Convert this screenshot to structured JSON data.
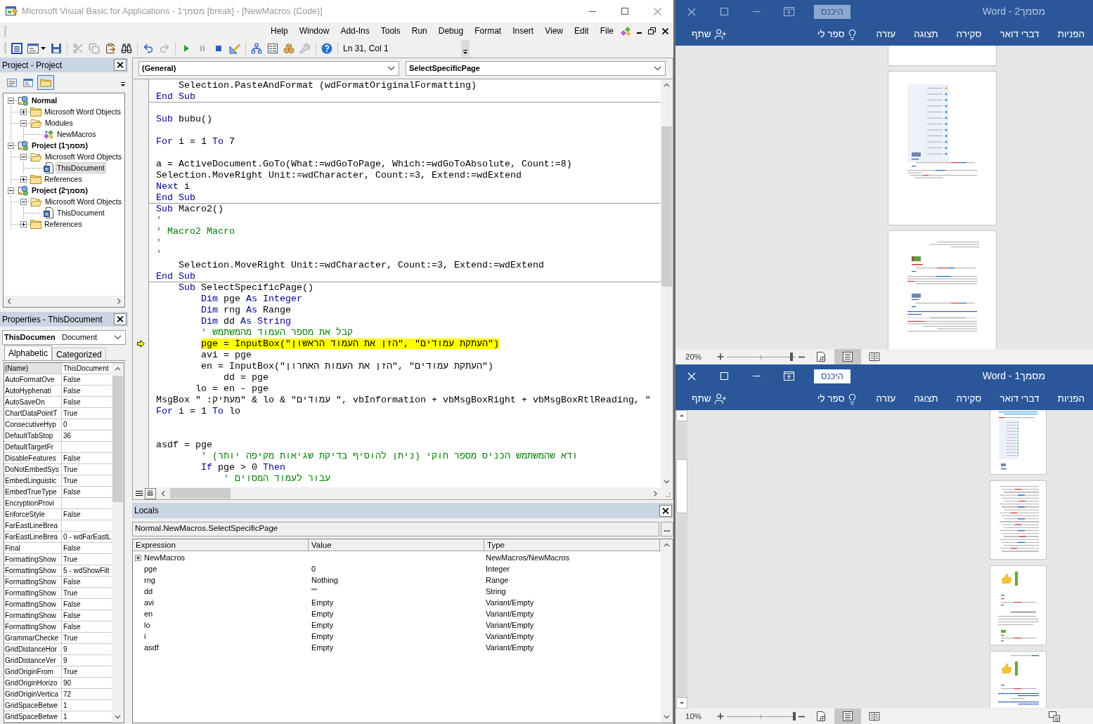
{
  "vba": {
    "title": "Microsoft Visual Basic for Applications - מסמך1 [break] - [NewMacros (Code)]",
    "menu": [
      "Help",
      "Window",
      "Add-Ins",
      "Tools",
      "Run",
      "Debug",
      "Format",
      "Insert",
      "View",
      "Edit",
      "File"
    ],
    "toolbar": {
      "position": "Ln 31, Col 1"
    },
    "project": {
      "title": "Project - Project",
      "view_buttons": [
        {
          "kind": "code",
          "selected": false
        },
        {
          "kind": "object",
          "selected": false
        },
        {
          "kind": "folders",
          "selected": true
        }
      ],
      "tree": [
        {
          "label": "Normal",
          "kind": "project",
          "expanded": true,
          "selected": false,
          "children": [
            {
              "label": "Microsoft Word Objects",
              "kind": "folder",
              "expanded": false,
              "selected": false
            },
            {
              "label": "Modules",
              "kind": "folder",
              "expanded": true,
              "selected": false,
              "children": [
                {
                  "label": "NewMacros",
                  "kind": "module",
                  "selected": false
                }
              ]
            }
          ]
        },
        {
          "label": "Project (מסמך1)",
          "kind": "project",
          "expanded": true,
          "selected": false,
          "children": [
            {
              "label": "Microsoft Word Objects",
              "kind": "folder",
              "expanded": true,
              "selected": false,
              "children": [
                {
                  "label": "ThisDocument",
                  "kind": "document",
                  "selected": true
                }
              ]
            },
            {
              "label": "References",
              "kind": "folder",
              "expanded": false,
              "selected": false
            }
          ]
        },
        {
          "label": "Project (מסמך2)",
          "kind": "project",
          "expanded": true,
          "selected": false,
          "children": [
            {
              "label": "Microsoft Word Objects",
              "kind": "folder",
              "expanded": true,
              "selected": false,
              "children": [
                {
                  "label": "ThisDocument",
                  "kind": "document",
                  "selected": false
                }
              ]
            },
            {
              "label": "References",
              "kind": "folder",
              "expanded": false,
              "selected": false
            }
          ]
        }
      ]
    },
    "properties": {
      "title": "Properties - ThisDocument",
      "object": "ThisDocumen",
      "object_type": "Document",
      "tabs": [
        {
          "label": "Alphabetic",
          "selected": true
        },
        {
          "label": "Categorized",
          "selected": false
        }
      ],
      "rows": [
        {
          "name": "(Name)",
          "value": "ThisDocument",
          "selected": true
        },
        {
          "name": "AutoFormatOve",
          "value": "False",
          "selected": false
        },
        {
          "name": "AutoHyphenati",
          "value": "False",
          "selected": false
        },
        {
          "name": "AutoSaveOn",
          "value": "False",
          "selected": false
        },
        {
          "name": "ChartDataPointT",
          "value": "True",
          "selected": false
        },
        {
          "name": "ConsecutiveHyp",
          "value": "0",
          "selected": false
        },
        {
          "name": "DefaultTabStop",
          "value": "36",
          "selected": false
        },
        {
          "name": "DefaultTargetFr",
          "selected": false
        },
        {
          "name": "DisableFeatures",
          "value": "False",
          "selected": false
        },
        {
          "name": "DoNotEmbedSys",
          "value": "True",
          "selected": false
        },
        {
          "name": "EmbedLinguistic",
          "value": "True",
          "selected": false
        },
        {
          "name": "EmbedTrueType",
          "value": "False",
          "selected": false
        },
        {
          "name": "EncryptionProvi",
          "selected": false
        },
        {
          "name": "EnforceStyle",
          "value": "False",
          "selected": false
        },
        {
          "name": "FarEastLineBrea",
          "selected": false
        },
        {
          "name": "FarEastLineBrea",
          "value": "0 - wdFarEastL",
          "selected": false
        },
        {
          "name": "Final",
          "value": "False",
          "selected": false
        },
        {
          "name": "FormattingShow",
          "value": "True",
          "selected": false
        },
        {
          "name": "FormattingShow",
          "value": "5 - wdShowFilt",
          "selected": false
        },
        {
          "name": "FormattingShow",
          "value": "False",
          "selected": false
        },
        {
          "name": "FormattingShow",
          "value": "True",
          "selected": false
        },
        {
          "name": "FormattingShow",
          "value": "False",
          "selected": false
        },
        {
          "name": "FormattingShow",
          "value": "False",
          "selected": false
        },
        {
          "name": "FormattingShow",
          "value": "False",
          "selected": false
        },
        {
          "name": "GrammarChecke",
          "value": "True",
          "selected": false
        },
        {
          "name": "GridDistanceHor",
          "value": "9",
          "selected": false
        },
        {
          "name": "GridDistanceVer",
          "value": "9",
          "selected": false
        },
        {
          "name": "GridOriginFrom",
          "value": "True",
          "selected": false
        },
        {
          "name": "GridOriginHorizo",
          "value": "90",
          "selected": false
        },
        {
          "name": "GridOriginVertica",
          "value": "72",
          "selected": false
        },
        {
          "name": "GridSpaceBetwe",
          "value": "1",
          "selected": false
        },
        {
          "name": "GridSpaceBetwe",
          "value": "1",
          "selected": false
        }
      ]
    },
    "code": {
      "object": "(General)",
      "procedure": "SelectSpecificPage",
      "procedures": [
        {
          "lines": [
            {
              "kind": "code",
              "current": false,
              "segments": [
                {
                  "kind": "plain",
                  "text": "    Selection.PasteAndFormat (wdFormatOriginalFormatting)"
                }
              ]
            },
            {
              "kind": "code",
              "current": false,
              "segments": [
                {
                  "kind": "keyword",
                  "text": "End Sub"
                }
              ]
            }
          ]
        },
        {
          "lines": [
            {
              "kind": "blank"
            },
            {
              "kind": "code",
              "current": false,
              "segments": [
                {
                  "kind": "keyword",
                  "text": "Sub"
                },
                {
                  "kind": "plain",
                  "text": " bubu()"
                }
              ]
            },
            {
              "kind": "blank"
            },
            {
              "kind": "code",
              "current": false,
              "segments": [
                {
                  "kind": "keyword",
                  "text": "For"
                },
                {
                  "kind": "plain",
                  "text": " i = 1 "
                },
                {
                  "kind": "keyword",
                  "text": "To"
                },
                {
                  "kind": "plain",
                  "text": " 7"
                }
              ]
            },
            {
              "kind": "blank"
            },
            {
              "kind": "code",
              "current": false,
              "segments": [
                {
                  "kind": "plain",
                  "text": "a = ActiveDocument.GoTo(What:=wdGoToPage, Which:=wdGoToAbsolute, Count:=8)"
                }
              ]
            },
            {
              "kind": "code",
              "current": false,
              "segments": [
                {
                  "kind": "plain",
                  "text": "Selection.MoveRight Unit:=wdCharacter, Count:=3, Extend:=wdExtend"
                }
              ]
            },
            {
              "kind": "code",
              "current": false,
              "segments": [
                {
                  "kind": "keyword",
                  "text": "Next"
                },
                {
                  "kind": "plain",
                  "text": " i"
                }
              ]
            },
            {
              "kind": "code",
              "current": false,
              "segments": [
                {
                  "kind": "keyword",
                  "text": "End Sub"
                }
              ]
            }
          ]
        },
        {
          "lines": [
            {
              "kind": "code",
              "current": false,
              "segments": [
                {
                  "kind": "keyword",
                  "text": "Sub"
                },
                {
                  "kind": "plain",
                  "text": " Macro2()"
                }
              ]
            },
            {
              "kind": "code",
              "current": false,
              "segments": [
                {
                  "kind": "comment",
                  "text": "'"
                }
              ]
            },
            {
              "kind": "code",
              "current": false,
              "segments": [
                {
                  "kind": "comment",
                  "text": "' Macro2 Macro"
                }
              ]
            },
            {
              "kind": "code",
              "current": false,
              "segments": [
                {
                  "kind": "comment",
                  "text": "'"
                }
              ]
            },
            {
              "kind": "code",
              "current": false,
              "segments": [
                {
                  "kind": "comment",
                  "text": "'"
                }
              ]
            },
            {
              "kind": "code",
              "current": false,
              "segments": [
                {
                  "kind": "plain",
                  "text": "    Selection.MoveRight Unit:=wdCharacter, Count:=3, Extend:=wdExtend"
                }
              ]
            },
            {
              "kind": "code",
              "current": false,
              "segments": [
                {
                  "kind": "keyword",
                  "text": "End Sub"
                }
              ]
            }
          ]
        },
        {
          "lines": [
            {
              "kind": "code",
              "current": false,
              "segments": [
                {
                  "kind": "keyword",
                  "text": "    Sub"
                },
                {
                  "kind": "plain",
                  "text": " SelectSpecificPage()"
                }
              ]
            },
            {
              "kind": "code",
              "current": false,
              "segments": [
                {
                  "kind": "keyword",
                  "text": "        Dim"
                },
                {
                  "kind": "plain",
                  "text": " pge "
                },
                {
                  "kind": "keyword",
                  "text": "As Integer"
                }
              ]
            },
            {
              "kind": "code",
              "current": false,
              "segments": [
                {
                  "kind": "keyword",
                  "text": "        Dim"
                },
                {
                  "kind": "plain",
                  "text": " rng "
                },
                {
                  "kind": "keyword",
                  "text": "As"
                },
                {
                  "kind": "plain",
                  "text": " Range"
                }
              ]
            },
            {
              "kind": "code",
              "current": false,
              "segments": [
                {
                  "kind": "keyword",
                  "text": "        Dim"
                },
                {
                  "kind": "plain",
                  "text": " dd "
                },
                {
                  "kind": "keyword",
                  "text": "As String"
                }
              ]
            },
            {
              "kind": "code",
              "current": false,
              "segments": [
                {
                  "kind": "comment",
                  "text": "        ' קבל את מספר העמוד מהמשתמש"
                }
              ]
            },
            {
              "kind": "code",
              "current": true,
              "segments": [
                {
                  "kind": "plain",
                  "text": "        pge = InputBox("
                },
                {
                  "kind": "string",
                  "text": "\"הזן את העמוד הראשון\""
                },
                {
                  "kind": "plain",
                  "text": ", "
                },
                {
                  "kind": "string",
                  "text": "\"העתקת עמודים\""
                },
                {
                  "kind": "plain",
                  "text": ")"
                }
              ]
            },
            {
              "kind": "code",
              "current": false,
              "segments": [
                {
                  "kind": "plain",
                  "text": "        avi = pge"
                }
              ]
            },
            {
              "kind": "code",
              "current": false,
              "segments": [
                {
                  "kind": "plain",
                  "text": "        en = InputBox("
                },
                {
                  "kind": "string",
                  "text": "\"הזן את העמות האחרון\""
                },
                {
                  "kind": "plain",
                  "text": ", "
                },
                {
                  "kind": "string",
                  "text": "\"העתקת עמודים\""
                },
                {
                  "kind": "plain",
                  "text": ")"
                }
              ]
            },
            {
              "kind": "code",
              "current": false,
              "segments": [
                {
                  "kind": "plain",
                  "text": "            dd = pge"
                }
              ]
            },
            {
              "kind": "code",
              "current": false,
              "segments": [
                {
                  "kind": "plain",
                  "text": "       lo = en - pge"
                }
              ]
            },
            {
              "kind": "code",
              "current": false,
              "segments": [
                {
                  "kind": "plain",
                  "text": "MsgBox "
                },
                {
                  "kind": "string",
                  "text": "\"מעתיק: \""
                },
                {
                  "kind": "plain",
                  "text": " & lo & "
                },
                {
                  "kind": "string",
                  "text": "\" עמודים\""
                },
                {
                  "kind": "plain",
                  "text": ", vbInformation + vbMsgBoxRight + vbMsgBoxRtlReading, \""
                }
              ]
            },
            {
              "kind": "code",
              "current": false,
              "segments": [
                {
                  "kind": "keyword",
                  "text": "For"
                },
                {
                  "kind": "plain",
                  "text": " i = 1 "
                },
                {
                  "kind": "keyword",
                  "text": "To"
                },
                {
                  "kind": "plain",
                  "text": " lo"
                }
              ]
            },
            {
              "kind": "blank"
            },
            {
              "kind": "blank"
            },
            {
              "kind": "code",
              "current": false,
              "segments": [
                {
                  "kind": "plain",
                  "text": "asdf = pge"
                }
              ]
            },
            {
              "kind": "code",
              "current": false,
              "segments": [
                {
                  "kind": "comment",
                  "text": "        ' ודא שהמשתמש הכניס מספר חוקי (ניתן להוסיף בדיקת שגיאות מקיפה יותר)"
                }
              ]
            },
            {
              "kind": "code",
              "current": false,
              "segments": [
                {
                  "kind": "keyword",
                  "text": "        If"
                },
                {
                  "kind": "plain",
                  "text": " pge > 0 "
                },
                {
                  "kind": "keyword",
                  "text": "Then"
                }
              ]
            },
            {
              "kind": "code",
              "current": false,
              "segments": [
                {
                  "kind": "comment",
                  "text": "            ' עבור לעמוד המסוים"
                }
              ]
            }
          ]
        }
      ]
    },
    "locals": {
      "title": "Locals",
      "context": "Normal.NewMacros.SelectSpecificPage",
      "call_stack_button": "...",
      "columns": [
        "Expression",
        "Value",
        "Type"
      ],
      "rows": [
        {
          "expression": "NewMacros",
          "type": "NewMacros/NewMacros",
          "expanded": false
        },
        {
          "expression": "pge",
          "value": "0",
          "type": "Integer"
        },
        {
          "expression": "rng",
          "value": "Nothing",
          "type": "Range"
        },
        {
          "expression": "dd",
          "value": "\"\"",
          "type": "String"
        },
        {
          "expression": "avi",
          "value": "Empty",
          "type": "Variant/Empty"
        },
        {
          "expression": "en",
          "value": "Empty",
          "type": "Variant/Empty"
        },
        {
          "expression": "lo",
          "value": "Empty",
          "type": "Variant/Empty"
        },
        {
          "expression": "i",
          "value": "Empty",
          "type": "Variant/Empty"
        },
        {
          "expression": "asdf",
          "value": "Empty",
          "type": "Variant/Empty"
        }
      ]
    }
  },
  "word_windows": [
    {
      "title": "מסמך2 - Word",
      "active": false,
      "sign_in": "היכנס",
      "tabs": [
        "הפניות",
        "דברי דואר",
        "סקירה",
        "תצוגה",
        "עזרה"
      ],
      "tell_me": "ספר לי",
      "share": "שתף",
      "zoom": {
        "reading": "20%",
        "level": 0.06
      },
      "view_buttons": [
        {
          "kind": "web_layout",
          "selected": false
        },
        {
          "kind": "print_layout",
          "selected": true
        },
        {
          "kind": "read_mode",
          "selected": false
        }
      ],
      "vertical_scrollbar": false,
      "display_settings": false
    },
    {
      "title": "מסמך1 - Word",
      "active": true,
      "sign_in": "היכנס",
      "tabs": [
        "הפניות",
        "דברי דואר",
        "סקירה",
        "תצוגה",
        "עזרה"
      ],
      "tell_me": "ספר לי",
      "share": "שתף",
      "zoom": {
        "reading": "10%",
        "level": 0.02
      },
      "view_buttons": [
        {
          "kind": "web_layout",
          "selected": false
        },
        {
          "kind": "print_layout",
          "selected": true
        },
        {
          "kind": "read_mode",
          "selected": false
        }
      ],
      "vertical_scrollbar": true,
      "display_settings": true
    }
  ]
}
